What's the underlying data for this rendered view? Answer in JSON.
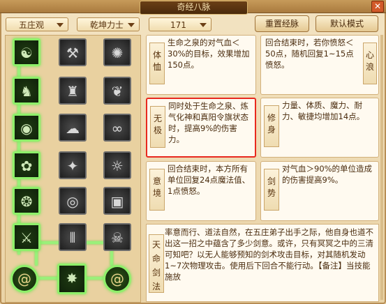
{
  "window": {
    "title": "奇经八脉",
    "close_icon": "close-icon"
  },
  "filters": {
    "school": "五庄观",
    "build": "乾坤力士",
    "level": "171"
  },
  "buttons": {
    "reset": "重置经脉",
    "default": "默认模式"
  },
  "skill_grid": {
    "rows": [
      [
        "tree-icon",
        "hammer-icon",
        "light-icon"
      ],
      [
        "figure-icon",
        "beast-icon",
        "heart-icon"
      ],
      [
        "qi-icon",
        "cloud-icon",
        "knot-icon"
      ],
      [
        "lotus-icon",
        "wolf-icon",
        "sun-icon"
      ],
      [
        "ring-icon",
        "spiral-icon",
        "seal-icon"
      ],
      [
        "sword-icon",
        "pillars-icon",
        "demon-icon"
      ]
    ],
    "active": [
      [
        1,
        0,
        0
      ],
      [
        1,
        0,
        0
      ],
      [
        1,
        0,
        0
      ],
      [
        1,
        0,
        0
      ],
      [
        1,
        0,
        0
      ],
      [
        1,
        0,
        0
      ]
    ],
    "bottom_row": [
      "coil-icon",
      "star-icon",
      "coil2-icon"
    ]
  },
  "cards": [
    {
      "name": "体恤",
      "text": "生命之泉的对气血＜30%的目标，效果增加150点。"
    },
    {
      "name": "心浪",
      "text": "回合结束时，若你愤怒＜50点，随机回复1~15点愤怒。"
    },
    {
      "name": "无极",
      "text": "同时处于生命之泉、炼气化神和真阳令旗状态时，提高9%的伤害力。"
    },
    {
      "name": "修身",
      "text": "力量、体质、魔力、耐力、敏捷均增加14点。"
    },
    {
      "name": "意境",
      "text": "回合结束时，本方所有单位回复24点魔法值、1点愤怒。"
    },
    {
      "name": "剑势",
      "text": "对气血＞90%的单位造成的伤害提高9%。"
    }
  ],
  "bottom_skill": {
    "name": "天命剑法",
    "text": "率意而行、道法自然，在五庄弟子出手之际，他自身也道不出这一招之中蕴含了多少剑意。或许，只有冥冥之中的三清可知吧？以无人能够预知的剑术攻击目标，对其随机发动1~7次物理攻击。使用后下回合不能行动。【备注】当技能施放"
  }
}
